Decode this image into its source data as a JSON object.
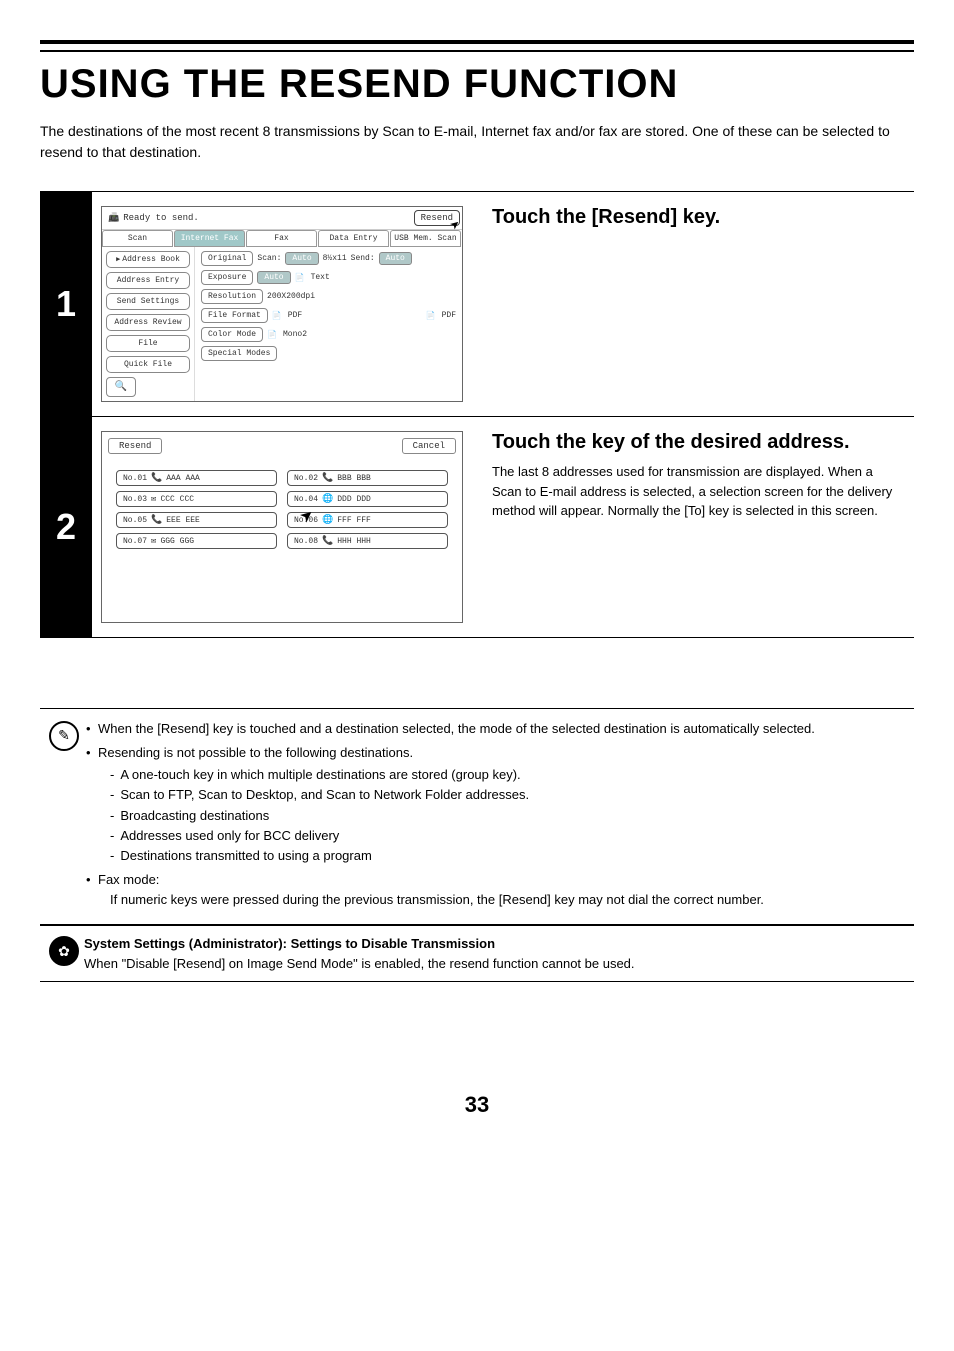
{
  "title": "USING THE RESEND FUNCTION",
  "intro": "The destinations of the most recent 8 transmissions by Scan to E-mail, Internet fax and/or fax are stored. One of these can be selected to resend to that destination.",
  "step1": {
    "num": "1",
    "heading": "Touch the [Resend] key.",
    "screen": {
      "status": "Ready to send.",
      "resend_btn": "Resend",
      "tabs": [
        "Scan",
        "Internet Fax",
        "Fax",
        "Data Entry",
        "USB Mem. Scan"
      ],
      "left_buttons": [
        "Address Book",
        "Address Entry",
        "Send Settings",
        "Address Review",
        "File",
        "Quick File"
      ],
      "rows": {
        "original": {
          "label": "Original",
          "scan_label": "Scan:",
          "scan_val": "Auto",
          "size": "8½x11",
          "send_label": "Send:",
          "send_val": "Auto"
        },
        "exposure": {
          "label": "Exposure",
          "val": "Auto",
          "mode": "Text"
        },
        "resolution": {
          "label": "Resolution",
          "val": "200X200dpi"
        },
        "format": {
          "label": "File Format",
          "v1": "PDF",
          "v2": "PDF"
        },
        "color": {
          "label": "Color Mode",
          "val": "Mono2"
        },
        "special": {
          "label": "Special Modes"
        }
      }
    }
  },
  "step2": {
    "num": "2",
    "heading": "Touch the key of the desired address.",
    "body": "The last 8 addresses used for transmission are displayed. When a Scan to E-mail address is selected, a selection screen for the delivery method will appear. Normally the [To] key is selected in this screen.",
    "screen": {
      "title": "Resend",
      "cancel": "Cancel",
      "items": [
        {
          "no": "No.01",
          "name": "AAA AAA",
          "icon": "📞"
        },
        {
          "no": "No.02",
          "name": "BBB BBB",
          "icon": "📞"
        },
        {
          "no": "No.03",
          "name": "CCC CCC",
          "icon": "✉"
        },
        {
          "no": "No.04",
          "name": "DDD DDD",
          "icon": "🌐"
        },
        {
          "no": "No.05",
          "name": "EEE EEE",
          "icon": "📞"
        },
        {
          "no": "No.06",
          "name": "FFF FFF",
          "icon": "🌐"
        },
        {
          "no": "No.07",
          "name": "GGG GGG",
          "icon": "✉"
        },
        {
          "no": "No.08",
          "name": "HHH HHH",
          "icon": "📞"
        }
      ]
    }
  },
  "notes": {
    "b1": "When the [Resend] key is touched and a destination selected, the mode of the selected destination is automatically selected.",
    "b2": "Resending is not possible to the following destinations.",
    "b2s": [
      "A one-touch key in which multiple destinations are stored (group key).",
      "Scan to FTP, Scan to Desktop, and Scan to Network Folder addresses.",
      "Broadcasting destinations",
      "Addresses used only for BCC delivery",
      "Destinations transmitted to using a program"
    ],
    "b3_label": "Fax mode:",
    "b3_text": "If numeric keys were pressed during the previous transmission, the [Resend] key may not dial the correct number."
  },
  "admin": {
    "title": "System Settings (Administrator): Settings to Disable Transmission",
    "body": "When \"Disable [Resend] on Image Send Mode\" is enabled, the resend function cannot be used."
  },
  "page": "33"
}
